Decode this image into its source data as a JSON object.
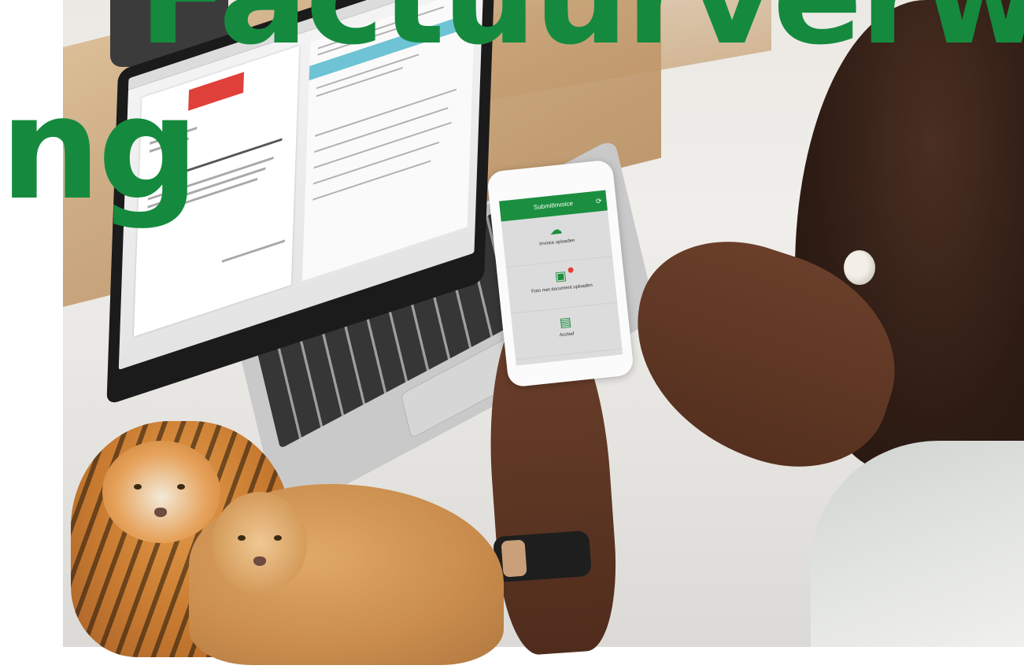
{
  "headline": {
    "line1": "Factuurverwerki",
    "line2": "ng",
    "color": "#158a3e"
  },
  "phone_app": {
    "header_title": "SubmitInvoice",
    "sync_icon": "sync-icon",
    "items": [
      {
        "icon": "cloud-upload-icon",
        "label": "Invoice uploaden"
      },
      {
        "icon": "photo-upload-icon",
        "label": "Foto met document uploaden"
      },
      {
        "icon": "archive-box-icon",
        "label": "Archief"
      }
    ],
    "accent_color": "#1b8f3f"
  },
  "laptop_app": {
    "highlight_color": "#6ec3d4",
    "logo_color": "#e0403a"
  }
}
